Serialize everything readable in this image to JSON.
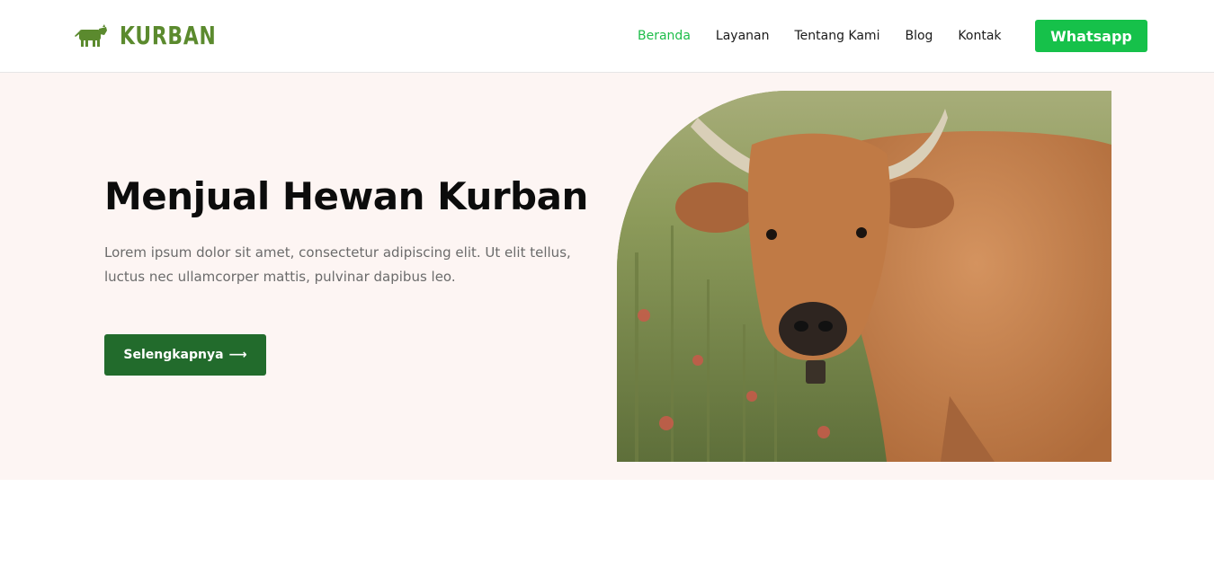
{
  "brand": {
    "name": "KURBAN",
    "icon": "cow-icon",
    "color": "#5b8a2e"
  },
  "nav": {
    "items": [
      {
        "label": "Beranda",
        "active": true
      },
      {
        "label": "Layanan",
        "active": false
      },
      {
        "label": "Tentang Kami",
        "active": false
      },
      {
        "label": "Blog",
        "active": false
      },
      {
        "label": "Kontak",
        "active": false
      }
    ],
    "active_color": "#1ebd4a",
    "whatsapp_label": "Whatsapp",
    "whatsapp_color": "#16c14a"
  },
  "hero": {
    "title": "Menjual Hewan Kurban",
    "description": "Lorem ipsum dolor sit amet, consectetur adipiscing elit. Ut elit tellus, luctus nec ullamcorper mattis, pulvinar dapibus leo.",
    "cta_label": "Selengkapnya",
    "cta_icon": "arrow-right-icon",
    "cta_color": "#226b2c",
    "background": "#fdf5f3",
    "image": "cow-in-meadow-photo"
  }
}
